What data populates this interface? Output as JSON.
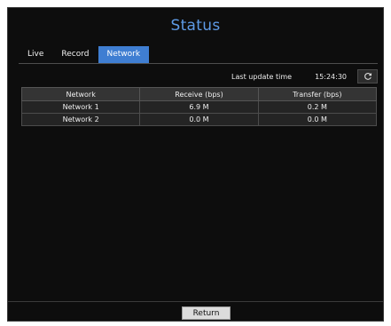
{
  "window": {
    "title": "Status"
  },
  "tabs": [
    {
      "label": "Live",
      "active": false
    },
    {
      "label": "Record",
      "active": false
    },
    {
      "label": "Network",
      "active": true
    }
  ],
  "update": {
    "label": "Last update time",
    "time": "15:24:30",
    "refresh_icon": "refresh-icon"
  },
  "table": {
    "headers": [
      "Network",
      "Receive (bps)",
      "Transfer (bps)"
    ],
    "rows": [
      [
        "Network 1",
        "6.9 M",
        "0.2 M"
      ],
      [
        "Network 2",
        "0.0 M",
        "0.0 M"
      ]
    ]
  },
  "footer": {
    "return_label": "Return"
  },
  "colors": {
    "accent": "#3f7ed2",
    "title": "#5e9be6",
    "background": "#0d0d0d"
  }
}
